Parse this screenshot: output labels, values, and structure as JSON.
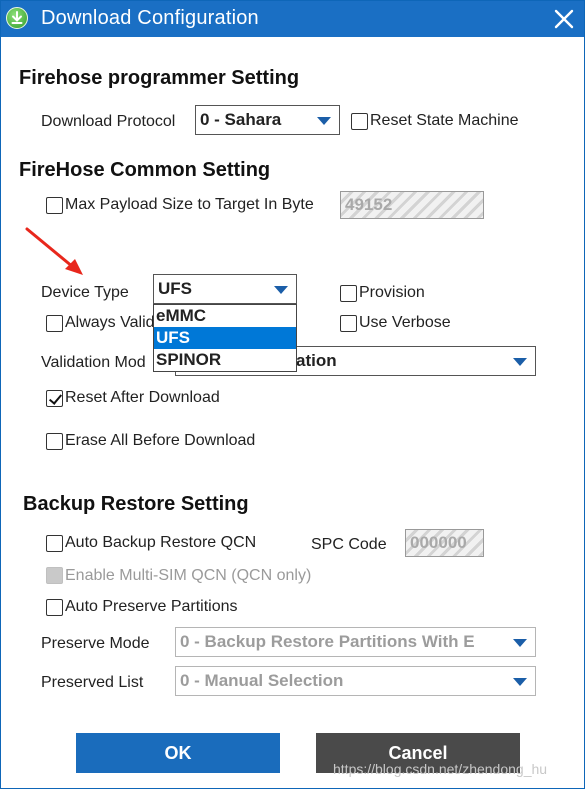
{
  "window": {
    "title": "Download Configuration"
  },
  "firehose_programmer": {
    "heading": "Firehose programmer Setting",
    "download_protocol_label": "Download Protocol",
    "download_protocol_value": "0 - Sahara",
    "reset_state_machine_label": "Reset State Machine",
    "reset_state_machine_checked": false
  },
  "firehose_common": {
    "heading": "FireHose Common Setting",
    "max_payload_label": "Max Payload Size to Target In Byte",
    "max_payload_checked": false,
    "max_payload_value": "49152",
    "device_type_label": "Device Type",
    "device_type_value": "UFS",
    "device_type_options": [
      "eMMC",
      "UFS",
      "SPINOR"
    ],
    "provision_label": "Provision",
    "always_validate_label": "Always Valid",
    "use_verbose_label": "Use Verbose",
    "validation_mode_label": "Validation Mod",
    "validation_mode_value": "ation",
    "reset_after_download_label": "Reset After Download",
    "reset_after_download_checked": true,
    "erase_all_label": "Erase All Before Download"
  },
  "backup_restore": {
    "heading": "Backup Restore Setting",
    "auto_backup_label": "Auto Backup Restore QCN",
    "spc_code_label": "SPC Code",
    "spc_code_value": "000000",
    "enable_multi_sim_label": "Enable Multi-SIM QCN (QCN only)",
    "auto_preserve_label": "Auto Preserve Partitions",
    "preserve_mode_label": "Preserve Mode",
    "preserve_mode_value": "0 - Backup Restore Partitions With E",
    "preserved_list_label": "Preserved List",
    "preserved_list_value": "0 - Manual Selection"
  },
  "buttons": {
    "ok": "OK",
    "cancel": "Cancel"
  },
  "watermark": "https://blog.csdn.net/zhendong_hu",
  "colors": {
    "titlebar": "#1a6fc4",
    "ok": "#1a6cbc",
    "cancel": "#4a4a4a",
    "arrow": "#e8271c",
    "selection": "#0078d7"
  }
}
